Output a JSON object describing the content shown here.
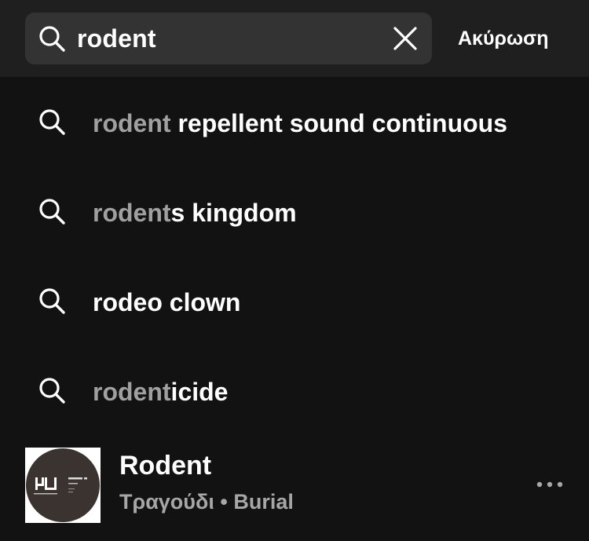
{
  "search": {
    "query": "rodent",
    "cancel_label": "Ακύρωση"
  },
  "icons": {
    "search": "search-icon",
    "clear": "close-icon",
    "more": "more-horizontal-icon"
  },
  "suggestions": [
    {
      "match": "rodent",
      "rest": " repellent sound continuous"
    },
    {
      "match": "rodent",
      "rest": "s kingdom"
    },
    {
      "match": "",
      "rest": "rodeo clown"
    },
    {
      "match": "rodent",
      "rest": "icide"
    }
  ],
  "result": {
    "title": "Rodent",
    "type": "Τραγούδι",
    "separator": " • ",
    "artist": "Burial",
    "cover_label": "BURIAL",
    "cover_logo": "HYPERDUB"
  },
  "colors": {
    "background": "#121212",
    "topbar": "#1f1f1f",
    "search_box": "#333333",
    "match_text": "#a0a0a0",
    "secondary_text": "#a7a7a7"
  }
}
